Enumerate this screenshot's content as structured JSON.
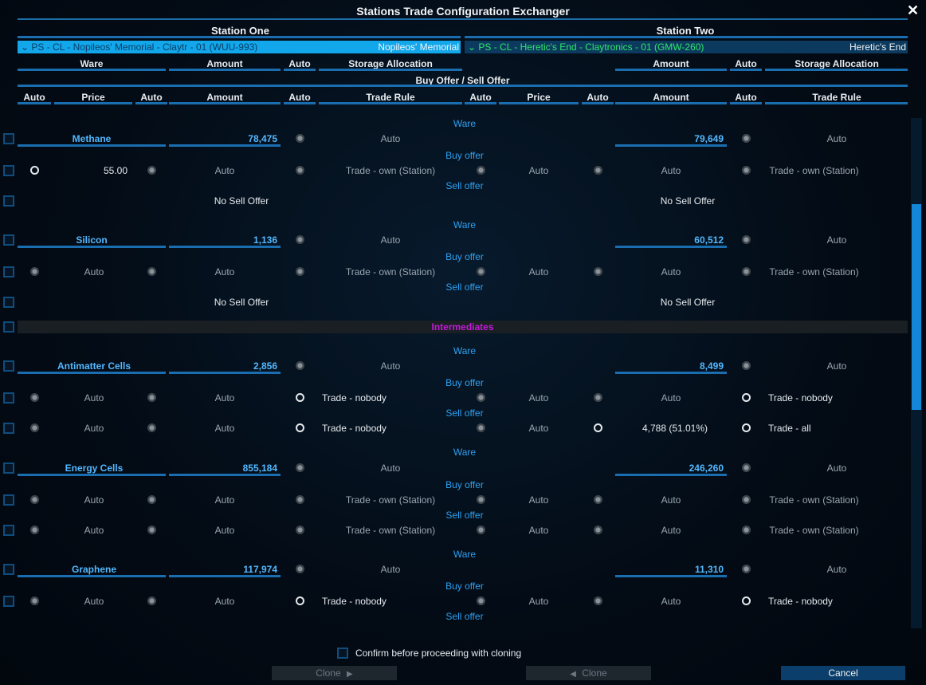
{
  "window": {
    "title": "Stations Trade Configuration Exchanger",
    "close_glyph": "✕"
  },
  "station_one": {
    "heading": "Station One",
    "selector_text": "⌄ PS - CL - Nopileos' Memorial - Claytr - 01 (WUU-993)",
    "selector_name": "Nopileos' Memorial"
  },
  "station_two": {
    "heading": "Station Two",
    "selector_text": "⌄ PS - CL - Heretic's End - Claytronics - 01 (GMW-260)",
    "selector_name": "Heretic's End"
  },
  "headers": {
    "ware": "Ware",
    "amount": "Amount",
    "auto": "Auto",
    "storage": "Storage Allocation",
    "buy_sell": "Buy Offer / Sell Offer",
    "price": "Price",
    "trade_rule": "Trade Rule"
  },
  "labels": {
    "ware": "Ware",
    "buy_offer": "Buy offer",
    "sell_offer": "Sell offer",
    "auto": "Auto",
    "no_sell_offer": "No Sell Offer",
    "intermediates": "Intermediates"
  },
  "wares": [
    {
      "name": "Methane",
      "s1_amount": "78,475",
      "s2_amount": "79,649",
      "buy": {
        "s1_price": "55.00",
        "s1_amount": "Auto",
        "s1_rule": "Trade - own (Station)",
        "s2_price": "Auto",
        "s2_amount": "Auto",
        "s2_rule": "Trade - own (Station)"
      },
      "sell": {
        "s1_text": "No Sell Offer",
        "s2_text": "No Sell Offer"
      }
    },
    {
      "name": "Silicon",
      "s1_amount": "1,136",
      "s2_amount": "60,512",
      "buy": {
        "s1_price": "Auto",
        "s1_amount": "Auto",
        "s1_rule": "Trade - own (Station)",
        "s2_price": "Auto",
        "s2_amount": "Auto",
        "s2_rule": "Trade - own (Station)"
      },
      "sell": {
        "s1_text": "No Sell Offer",
        "s2_text": "No Sell Offer"
      }
    },
    {
      "name": "Antimatter Cells",
      "s1_amount": "2,856",
      "s2_amount": "8,499",
      "buy": {
        "s1_price": "Auto",
        "s1_amount": "Auto",
        "s1_rule": "Trade - nobody",
        "s2_price": "Auto",
        "s2_amount": "Auto",
        "s2_rule": "Trade - nobody"
      },
      "sell": {
        "s1_price": "Auto",
        "s1_amount": "Auto",
        "s1_rule": "Trade - nobody",
        "s2_price": "Auto",
        "s2_amount": "4,788 (51.01%)",
        "s2_rule": "Trade - all"
      }
    },
    {
      "name": "Energy Cells",
      "s1_amount": "855,184",
      "s2_amount": "246,260",
      "buy": {
        "s1_price": "Auto",
        "s1_amount": "Auto",
        "s1_rule": "Trade - own (Station)",
        "s2_price": "Auto",
        "s2_amount": "Auto",
        "s2_rule": "Trade - own (Station)"
      },
      "sell": {
        "s1_price": "Auto",
        "s1_amount": "Auto",
        "s1_rule": "Trade - own (Station)",
        "s2_price": "Auto",
        "s2_amount": "Auto",
        "s2_rule": "Trade - own (Station)"
      }
    },
    {
      "name": "Graphene",
      "s1_amount": "117,974",
      "s2_amount": "11,310",
      "buy": {
        "s1_price": "Auto",
        "s1_amount": "Auto",
        "s1_rule": "Trade - nobody",
        "s2_price": "Auto",
        "s2_amount": "Auto",
        "s2_rule": "Trade - nobody"
      }
    }
  ],
  "footer": {
    "confirm_label": "Confirm before proceeding with cloning",
    "clone_right": "Clone",
    "clone_left": "Clone",
    "cancel": "Cancel",
    "arrow_right": "▶",
    "arrow_left": "◀"
  }
}
